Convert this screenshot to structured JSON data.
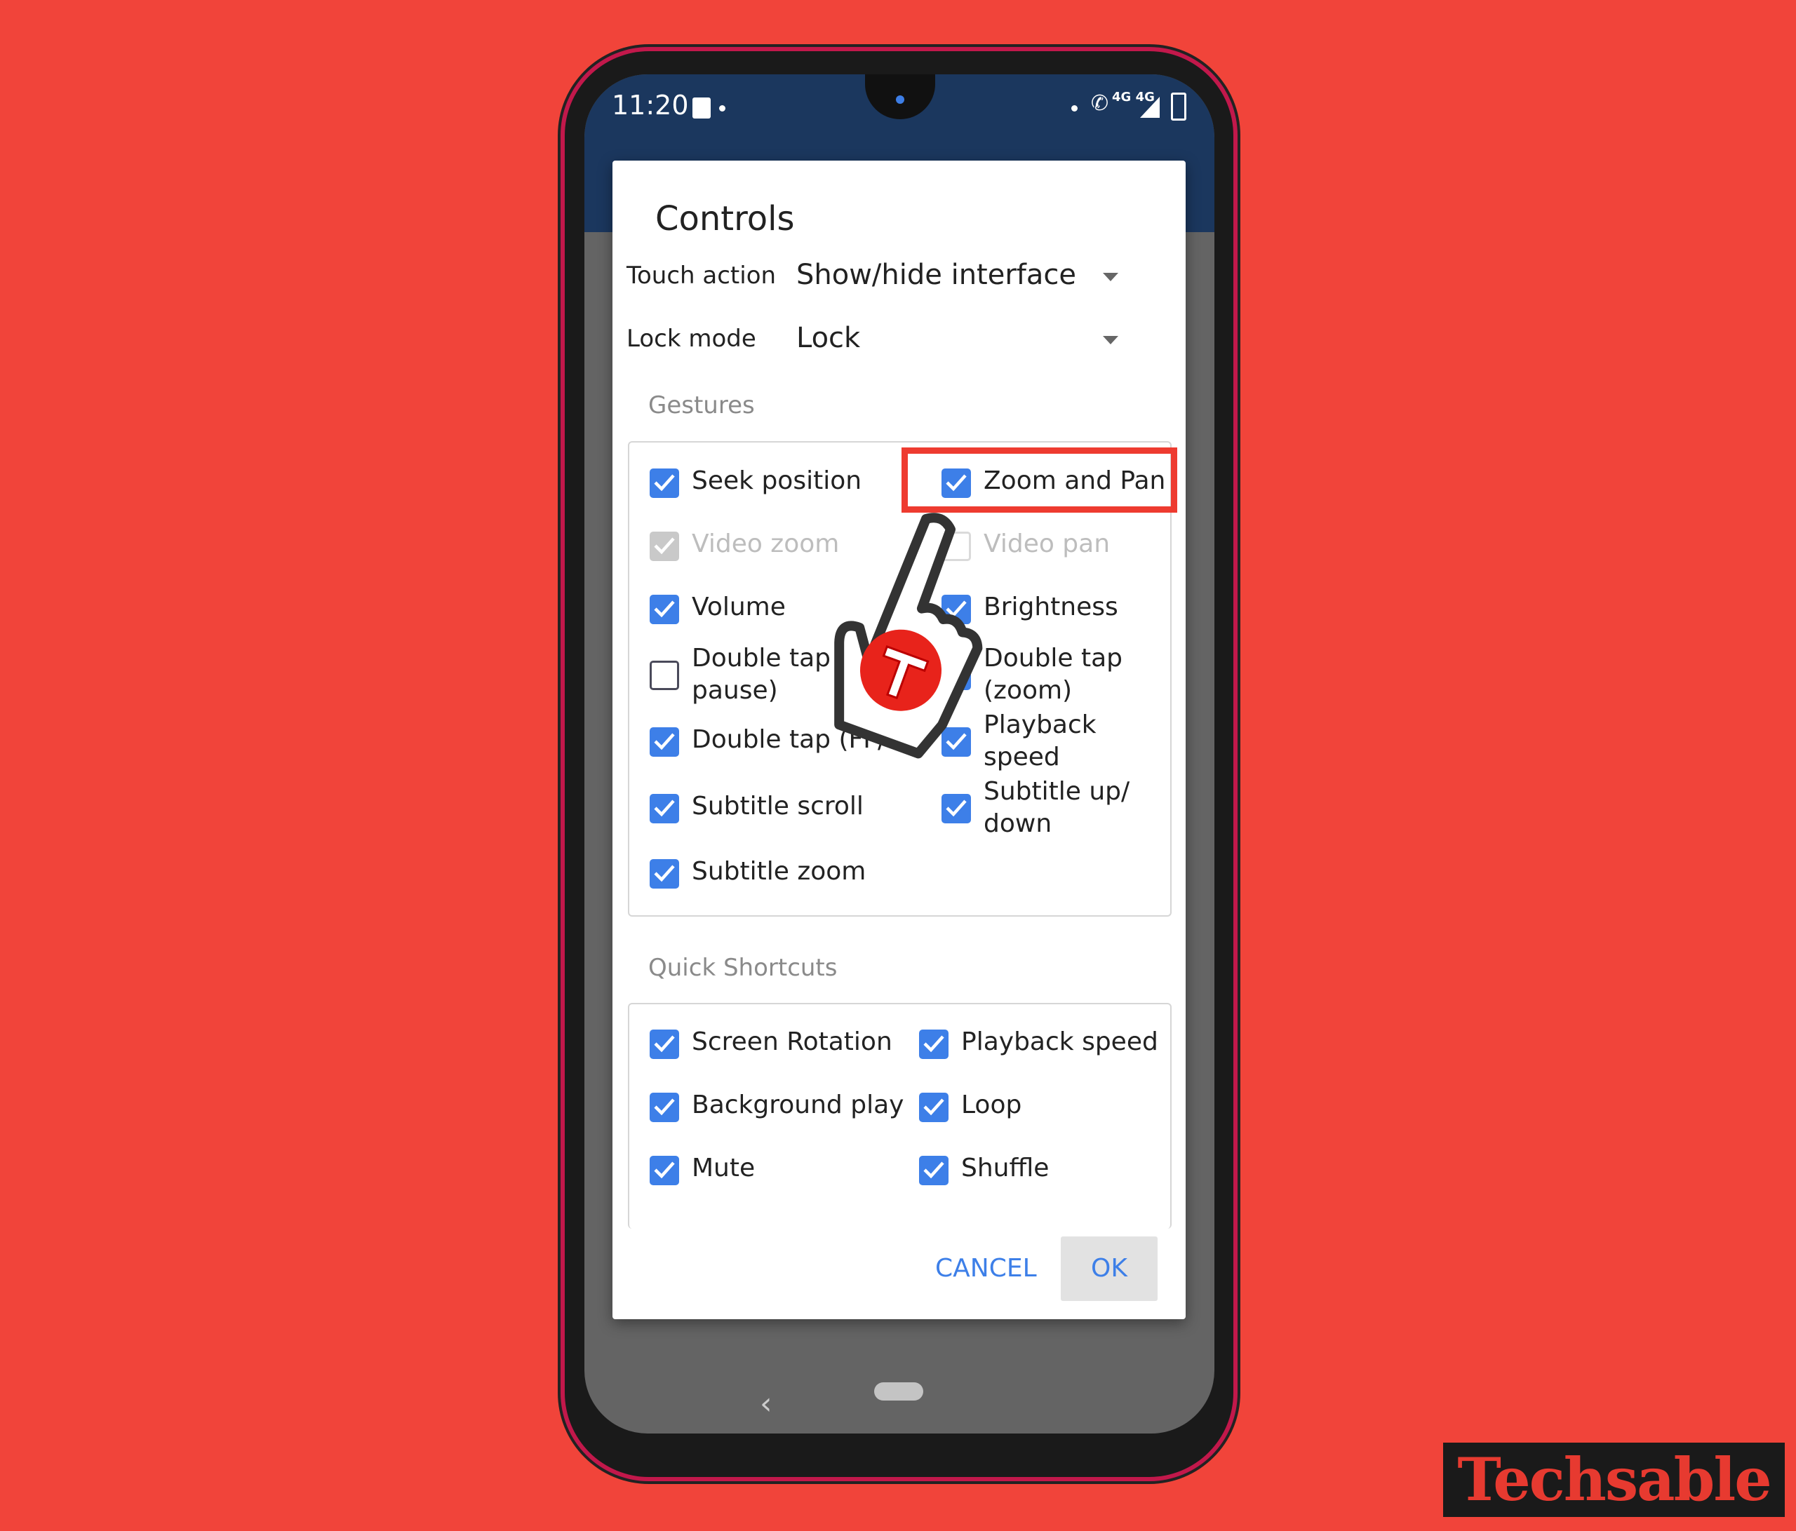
{
  "status_bar": {
    "time": "11:20",
    "network": "4G 4G",
    "icons": [
      "notification-icon",
      "call-icon",
      "signal-icon",
      "battery-charging-icon"
    ]
  },
  "dialog": {
    "title": "Controls",
    "touch_action": {
      "label": "Touch action",
      "value": "Show/hide interface"
    },
    "lock_mode": {
      "label": "Lock mode",
      "value": "Lock"
    },
    "gestures": {
      "header": "Gestures",
      "items": [
        {
          "label": "Seek position",
          "checked": true,
          "enabled": true
        },
        {
          "label": "Zoom and Pan",
          "checked": true,
          "enabled": true,
          "highlighted": true
        },
        {
          "label": "Video zoom",
          "checked": true,
          "enabled": false
        },
        {
          "label": "Video pan",
          "checked": false,
          "enabled": false
        },
        {
          "label": "Volume",
          "checked": true,
          "enabled": true
        },
        {
          "label": "Brightness",
          "checked": true,
          "enabled": true
        },
        {
          "label": "Double tap (play/pause)",
          "line1": "Double tap (",
          "line2": "pause)",
          "checked": false,
          "enabled": true
        },
        {
          "label": "Double tap (zoom)",
          "line1": "Double tap",
          "line2": "(zoom)",
          "checked": true,
          "enabled": true
        },
        {
          "label": "Double tap (FF/REW)",
          "line1": "Double tap (FF/R",
          "checked": true,
          "enabled": true
        },
        {
          "label": "Playback speed",
          "line1": "Playback",
          "line2": "speed",
          "checked": true,
          "enabled": true
        },
        {
          "label": "Subtitle scroll",
          "checked": true,
          "enabled": true
        },
        {
          "label": "Subtitle up/down",
          "line1": "Subtitle up/",
          "line2": "down",
          "checked": true,
          "enabled": true
        },
        {
          "label": "Subtitle zoom",
          "checked": true,
          "enabled": true
        }
      ]
    },
    "quick_shortcuts": {
      "header": "Quick Shortcuts",
      "items": [
        {
          "label": "Screen Rotation",
          "checked": true
        },
        {
          "label": "Playback speed",
          "checked": true
        },
        {
          "label": "Background play",
          "checked": true
        },
        {
          "label": "Loop",
          "checked": true
        },
        {
          "label": "Mute",
          "checked": true
        },
        {
          "label": "Shuffle",
          "checked": true
        }
      ]
    },
    "cancel_label": "CANCEL",
    "ok_label": "OK"
  },
  "watermark": "Techsable",
  "colors": {
    "background": "#f1443a",
    "accent": "#3d7fe8",
    "appbar": "#1b375e",
    "highlight": "#ee3b30"
  }
}
